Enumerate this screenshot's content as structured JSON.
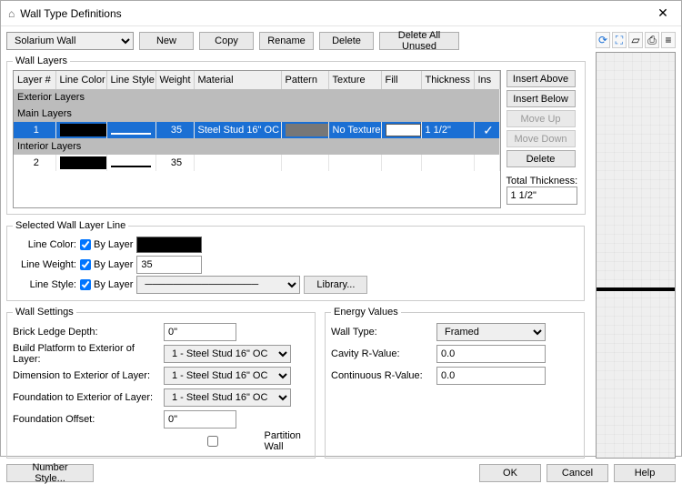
{
  "titlebar": {
    "icon": "⌂",
    "title": "Wall Type Definitions"
  },
  "wallTypeSelect": "Solarium Wall",
  "topButtons": {
    "new": "New",
    "copy": "Copy",
    "rename": "Rename",
    "delete": "Delete",
    "deleteUnused": "Delete All Unused"
  },
  "wallLayers": {
    "legend": "Wall Layers",
    "headers": {
      "layerNum": "Layer #",
      "lineColor": "Line Color",
      "lineStyle": "Line Style",
      "weight": "Weight",
      "material": "Material",
      "pattern": "Pattern",
      "texture": "Texture",
      "fill": "Fill",
      "thickness": "Thickness",
      "ins": "Ins"
    },
    "sections": {
      "exterior": "Exterior Layers",
      "main": "Main Layers",
      "interior": "Interior Layers"
    },
    "rows": [
      {
        "section": "main",
        "num": "1",
        "lineColor": "#000000",
        "lineStyleColor": "#fff",
        "weight": "35",
        "material": "Steel Stud 16\" OC",
        "pattern": "",
        "texture": "No Texture",
        "fill": "#ffffff",
        "thickness": "1 1/2\"",
        "ins": "✓",
        "selected": true
      },
      {
        "section": "interior",
        "num": "2",
        "lineColor": "#000000",
        "lineStyleColor": "#000",
        "weight": "35",
        "material": "",
        "pattern": "",
        "texture": "",
        "fill": "",
        "thickness": "",
        "ins": "",
        "selected": false
      }
    ],
    "sideButtons": {
      "insertAbove": "Insert Above",
      "insertBelow": "Insert Below",
      "moveUp": "Move Up",
      "moveDown": "Move Down",
      "delete": "Delete"
    },
    "totalThicknessLabel": "Total Thickness:",
    "totalThickness": "1 1/2\""
  },
  "selectedLayerLine": {
    "legend": "Selected Wall Layer Line",
    "lineColorLabel": "Line Color:",
    "lineWeightLabel": "Line Weight:",
    "lineStyleLabel": "Line Style:",
    "byLayer": "By Layer",
    "lineWeight": "35",
    "libraryBtn": "Library..."
  },
  "wallSettings": {
    "legend": "Wall Settings",
    "brickLedge": {
      "label": "Brick Ledge Depth:",
      "value": "0\""
    },
    "buildPlatform": {
      "label": "Build Platform to Exterior of Layer:",
      "value": "1 - Steel Stud 16\" OC"
    },
    "dimExt": {
      "label": "Dimension to Exterior of Layer:",
      "value": "1 - Steel Stud 16\" OC"
    },
    "foundExt": {
      "label": "Foundation to Exterior of Layer:",
      "value": "1 - Steel Stud 16\" OC"
    },
    "foundOffset": {
      "label": "Foundation Offset:",
      "value": "0\""
    },
    "partitionWall": "Partition Wall"
  },
  "energyValues": {
    "legend": "Energy Values",
    "wallType": {
      "label": "Wall Type:",
      "value": "Framed"
    },
    "cavityR": {
      "label": "Cavity R-Value:",
      "value": "0.0"
    },
    "contR": {
      "label": "Continuous R-Value:",
      "value": "0.0"
    }
  },
  "footer": {
    "numberStyle": "Number Style...",
    "ok": "OK",
    "cancel": "Cancel",
    "help": "Help"
  }
}
